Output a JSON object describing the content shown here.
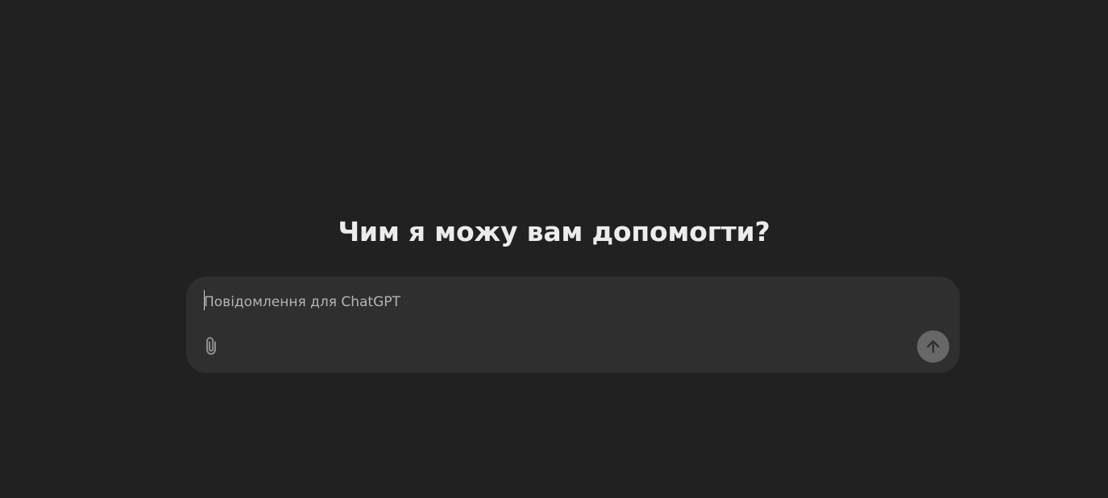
{
  "main": {
    "heading": "Чим я можу вам допомогти?"
  },
  "composer": {
    "value": "",
    "placeholder": "Повідомлення для ChatGPT",
    "attach_icon": "paperclip-icon",
    "send_icon": "arrow-up-icon"
  },
  "colors": {
    "background": "#212121",
    "composer_background": "#2f2f2f",
    "heading_text": "#ececec",
    "placeholder_text": "#b4b4b4",
    "send_button_disabled": "#676767"
  }
}
